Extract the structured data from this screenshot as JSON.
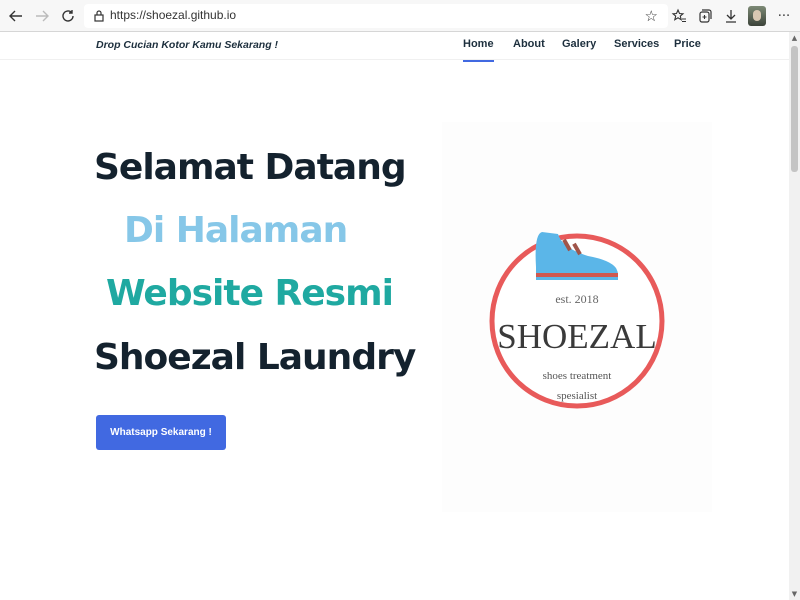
{
  "browser": {
    "url": "https://shoezal.github.io",
    "icons": [
      "back-icon",
      "forward-icon",
      "reload-icon",
      "lock-icon",
      "favorite-add-icon",
      "favorites-icon",
      "collections-icon",
      "download-icon",
      "profile-avatar",
      "more-icon"
    ]
  },
  "header": {
    "tagline": "Drop Cucian Kotor Kamu Sekarang !",
    "nav": [
      "Home",
      "About",
      "Galery",
      "Services",
      "Price"
    ],
    "active": "Home",
    "accent": "#4169e1"
  },
  "hero": {
    "line1": "Selamat Datang",
    "line2": "Di Halaman",
    "line3": "Website Resmi",
    "line4": "Shoezal Laundry",
    "colors": {
      "dark": "#14222e",
      "light_blue": "#86c7e8",
      "teal": "#1fa9a1"
    },
    "button": "Whatsapp Sekarang !"
  },
  "logo": {
    "est": "est. 2018",
    "brand": "SHOEZAL",
    "sub1": "shoes treatment",
    "sub2": "spesialist",
    "ring_color": "#e85a5a",
    "shoe_color": "#5bb6e8"
  }
}
